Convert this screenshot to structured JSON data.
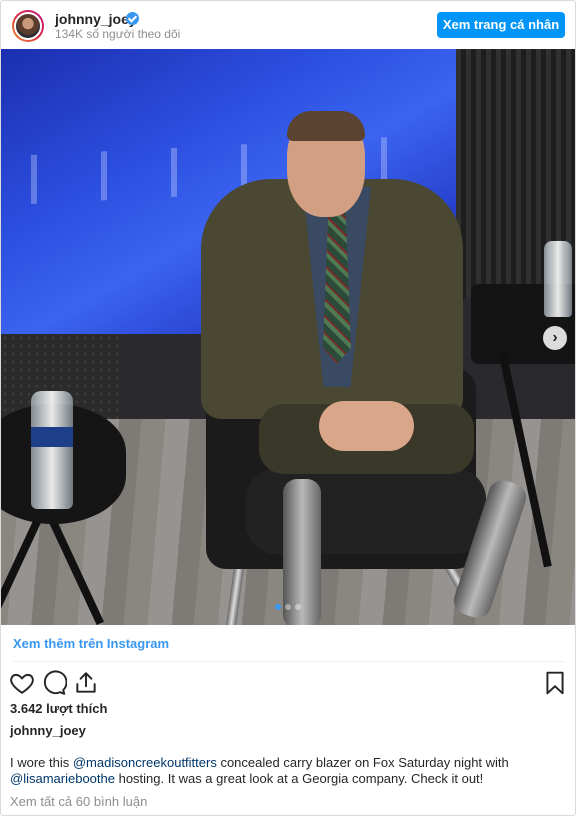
{
  "header": {
    "username": "johnny_joey",
    "followers": "134K số người theo dõi",
    "view_profile_label": "Xem trang cá nhân"
  },
  "post": {
    "see_more_label": "Xem thêm trên Instagram",
    "likes": "3.642 lượt thích",
    "author": "johnny_joey",
    "caption": {
      "part1": "I wore this ",
      "mention1": "@madisoncreekoutfitters",
      "part2": " concealed carry blazer on Fox Saturday night with ",
      "mention2": "@lisamarieboothe",
      "part3": " hosting. It was a great look at a Georgia company. Check it out!"
    },
    "view_comments": "Xem tất cả 60 bình luận"
  },
  "icons": {
    "verified": "verified-badge-icon",
    "like": "heart-icon",
    "comment": "comment-bubble-icon",
    "share": "share-icon",
    "save": "bookmark-icon",
    "next": "chevron-right-icon"
  },
  "carousel": {
    "current": 1,
    "total": 3
  },
  "colors": {
    "accent": "#0095f6",
    "link": "#3897f0",
    "mention": "#00376b",
    "muted": "#8e8e8e"
  }
}
